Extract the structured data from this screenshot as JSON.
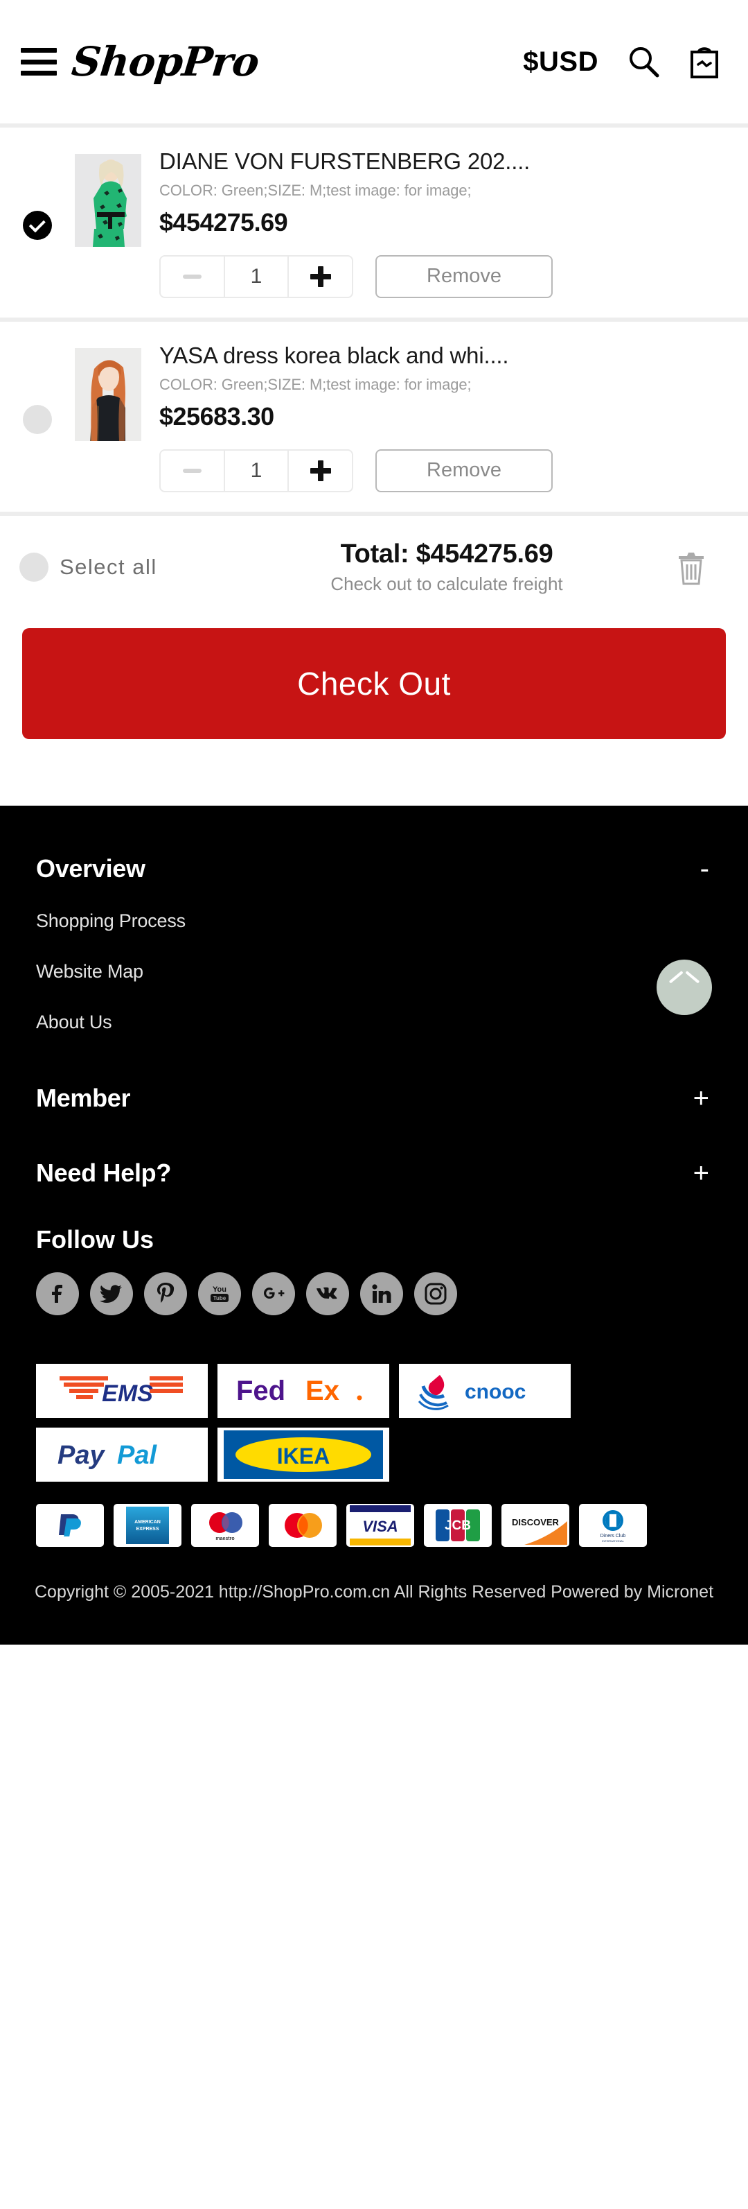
{
  "header": {
    "menu_icon": "hamburger-menu-icon",
    "brand": "ShopPro",
    "currency": "$USD",
    "search_icon": "search-icon",
    "cart_icon": "shopping-bag-icon"
  },
  "cart": {
    "items": [
      {
        "selected": true,
        "title": "DIANE VON FURSTENBERG 202....",
        "options": "COLOR: Green;SIZE: M;test image: for image;",
        "price": "$454275.69",
        "quantity": "1",
        "minus_label": "−",
        "plus_label": "+",
        "remove_label": "Remove",
        "image_alt": "blonde-model-green-dress"
      },
      {
        "selected": false,
        "title": "YASA dress korea black and whi....",
        "options": "COLOR: Green;SIZE: M;test image: for image;",
        "price": "$25683.30",
        "quantity": "1",
        "minus_label": "−",
        "plus_label": "+",
        "remove_label": "Remove",
        "image_alt": "redhead-model-black-dress"
      }
    ],
    "summary": {
      "select_all_label": "Select all",
      "select_all_checked": false,
      "total": "Total: $454275.69",
      "freight_note": "Check out to calculate freight",
      "trash_icon": "trash-can-icon"
    },
    "checkout_label": "Check Out"
  },
  "colors": {
    "checkout_red": "#c71414",
    "footer_bg": "#000000",
    "scroll_top_bg": "#c3cec5",
    "social_bg": "#a6a6a6"
  },
  "footer": {
    "sections": [
      {
        "title": "Overview",
        "toggle": "-",
        "expanded": true,
        "links": [
          "Shopping Process",
          "Website Map",
          "About Us"
        ]
      },
      {
        "title": "Member",
        "toggle": "+",
        "expanded": false,
        "links": []
      },
      {
        "title": "Need Help?",
        "toggle": "+",
        "expanded": false,
        "links": []
      }
    ],
    "scroll_top_icon": "chevron-up-icon",
    "follow_title": "Follow Us",
    "social": [
      {
        "name": "facebook-icon",
        "label": "Facebook"
      },
      {
        "name": "twitter-icon",
        "label": "Twitter"
      },
      {
        "name": "pinterest-icon",
        "label": "Pinterest"
      },
      {
        "name": "youtube-icon",
        "label": "YouTube"
      },
      {
        "name": "google-plus-icon",
        "label": "Google Plus"
      },
      {
        "name": "vk-icon",
        "label": "VK"
      },
      {
        "name": "linkedin-icon",
        "label": "LinkedIn"
      },
      {
        "name": "instagram-icon",
        "label": "Instagram"
      }
    ],
    "partners": [
      {
        "name": "ems-logo",
        "label": "EMS"
      },
      {
        "name": "fedex-logo",
        "label": "FedEx"
      },
      {
        "name": "cnooc-logo",
        "label": "cnooc"
      },
      {
        "name": "paypal-logo",
        "label": "PayPal"
      },
      {
        "name": "ikea-logo",
        "label": "IKEA"
      }
    ],
    "payments": [
      {
        "name": "paypal-card",
        "label": "PayPal"
      },
      {
        "name": "amex-card",
        "label": "American Express"
      },
      {
        "name": "maestro-card",
        "label": "Maestro"
      },
      {
        "name": "mastercard-card",
        "label": "Mastercard"
      },
      {
        "name": "visa-card",
        "label": "VISA"
      },
      {
        "name": "jcb-card",
        "label": "JCB"
      },
      {
        "name": "discover-card",
        "label": "DISCOVER"
      },
      {
        "name": "diners-club-card",
        "label": "Diners Club"
      }
    ],
    "copyright": "Copyright © 2005-2021 http://ShopPro.com.cn All Rights Reserved Powered by Micronet"
  }
}
